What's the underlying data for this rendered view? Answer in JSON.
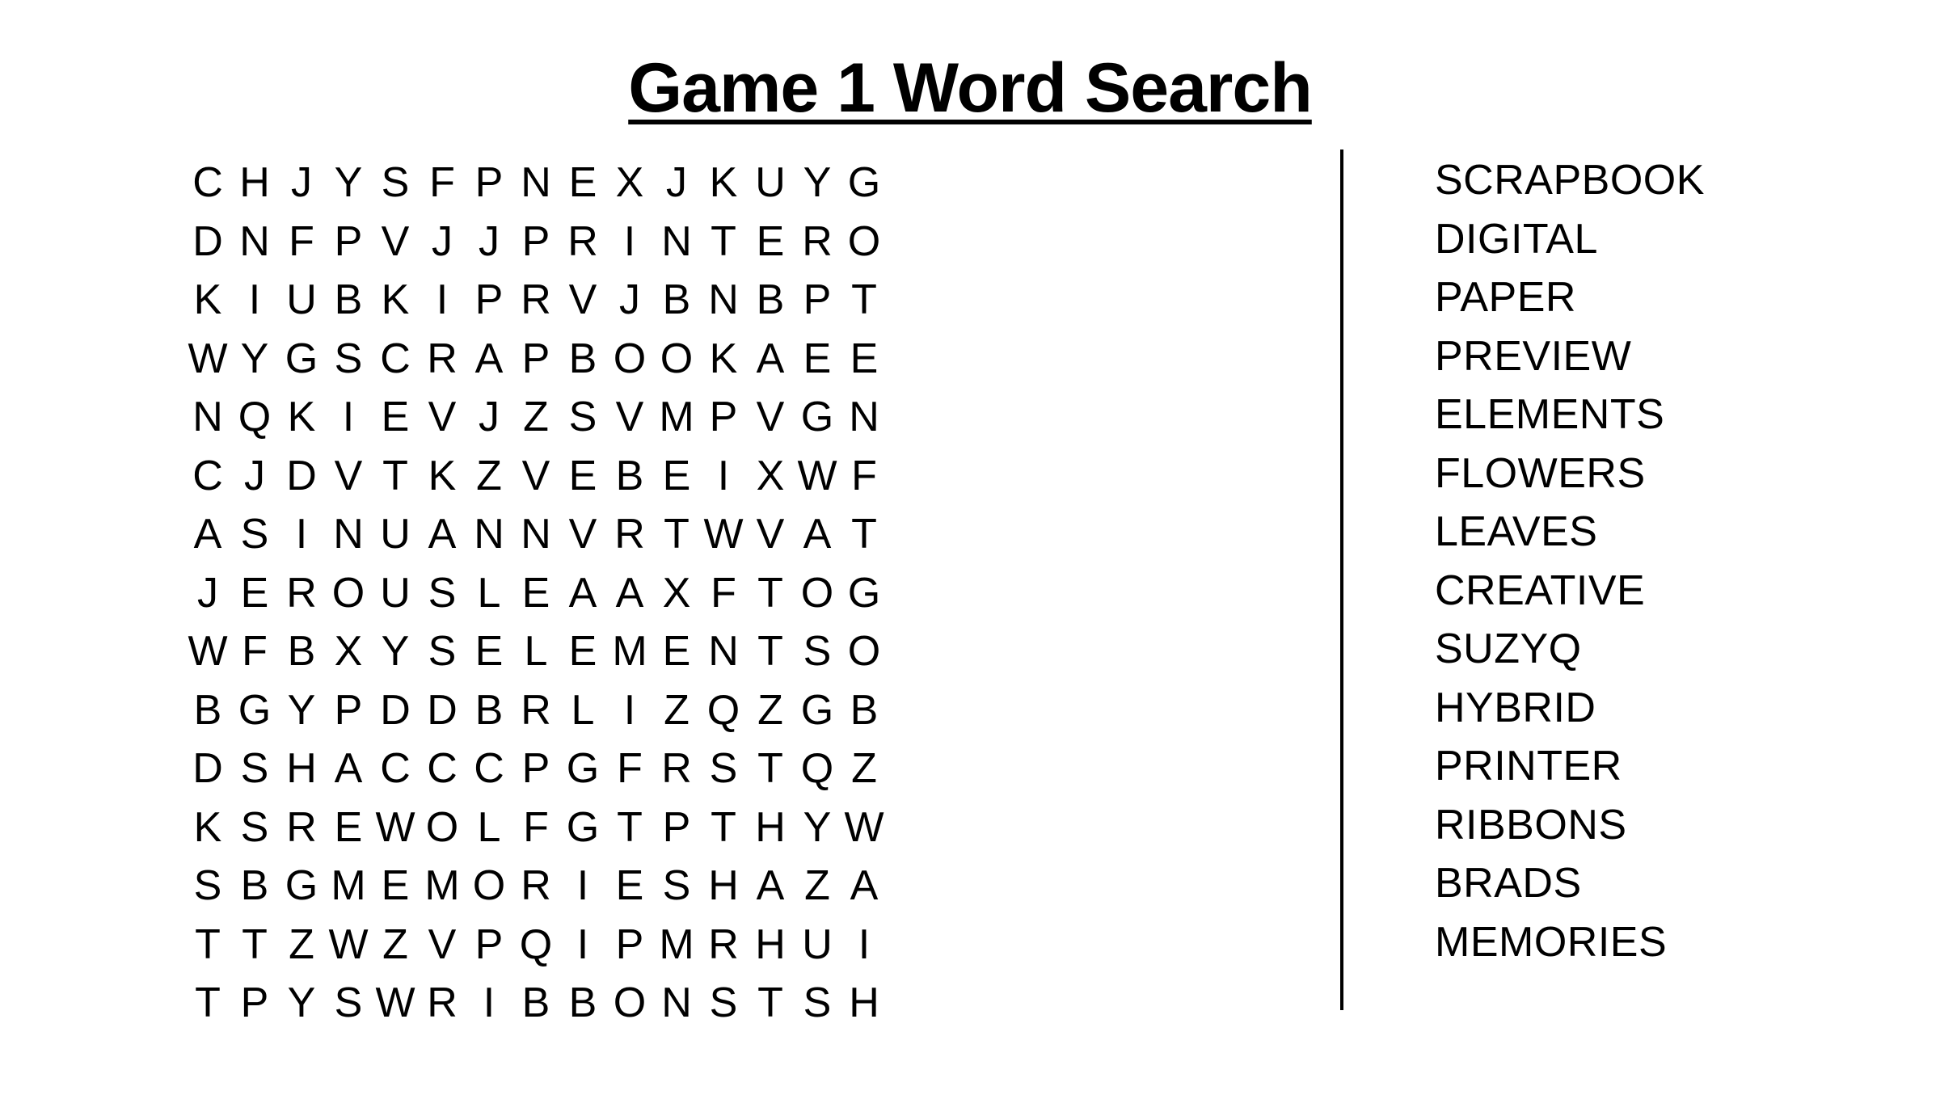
{
  "page": {
    "title": "Game 1 Word Search",
    "background_color": "#ffffff",
    "text_color": "#000000"
  },
  "puzzle": {
    "rows": 15,
    "columns": 15,
    "divider_color": "#000000",
    "grid": [
      [
        "C",
        "H",
        "J",
        "Y",
        "S",
        "F",
        "P",
        "N",
        "E",
        "X",
        "J",
        "K",
        "U",
        "Y",
        "G"
      ],
      [
        "D",
        "N",
        "F",
        "P",
        "V",
        "J",
        "J",
        "P",
        "R",
        "I",
        "N",
        "T",
        "E",
        "R",
        "O"
      ],
      [
        "K",
        "I",
        "U",
        "B",
        "K",
        "I",
        "P",
        "R",
        "V",
        "J",
        "B",
        "N",
        "B",
        "P",
        "T"
      ],
      [
        "W",
        "Y",
        "G",
        "S",
        "C",
        "R",
        "A",
        "P",
        "B",
        "O",
        "O",
        "K",
        "A",
        "E",
        "E"
      ],
      [
        "N",
        "Q",
        "K",
        "I",
        "E",
        "V",
        "J",
        "Z",
        "S",
        "V",
        "M",
        "P",
        "V",
        "G",
        "N"
      ],
      [
        "C",
        "J",
        "D",
        "V",
        "T",
        "K",
        "Z",
        "V",
        "E",
        "B",
        "E",
        "I",
        "X",
        "W",
        "F"
      ],
      [
        "A",
        "S",
        "I",
        "N",
        "U",
        "A",
        "N",
        "N",
        "V",
        "R",
        "T",
        "W",
        "V",
        "A",
        "T"
      ],
      [
        "J",
        "E",
        "R",
        "O",
        "U",
        "S",
        "L",
        "E",
        "A",
        "A",
        "X",
        "F",
        "T",
        "O",
        "G"
      ],
      [
        "W",
        "F",
        "B",
        "X",
        "Y",
        "S",
        "E",
        "L",
        "E",
        "M",
        "E",
        "N",
        "T",
        "S",
        "O"
      ],
      [
        "B",
        "G",
        "Y",
        "P",
        "D",
        "D",
        "B",
        "R",
        "L",
        "I",
        "Z",
        "Q",
        "Z",
        "G",
        "B"
      ],
      [
        "D",
        "S",
        "H",
        "A",
        "C",
        "C",
        "C",
        "P",
        "G",
        "F",
        "R",
        "S",
        "T",
        "Q",
        "Z"
      ],
      [
        "K",
        "S",
        "R",
        "E",
        "W",
        "O",
        "L",
        "F",
        "G",
        "T",
        "P",
        "T",
        "H",
        "Y",
        "W"
      ],
      [
        "S",
        "B",
        "G",
        "M",
        "E",
        "M",
        "O",
        "R",
        "I",
        "E",
        "S",
        "H",
        "A",
        "Z",
        "A"
      ],
      [
        "T",
        "T",
        "Z",
        "W",
        "Z",
        "V",
        "P",
        "Q",
        "I",
        "P",
        "M",
        "R",
        "H",
        "U",
        "I"
      ],
      [
        "T",
        "P",
        "Y",
        "S",
        "W",
        "R",
        "I",
        "B",
        "B",
        "O",
        "N",
        "S",
        "T",
        "S",
        "H"
      ]
    ]
  },
  "word_list": {
    "words": [
      "SCRAPBOOK",
      "DIGITAL",
      "PAPER",
      "PREVIEW",
      "ELEMENTS",
      "FLOWERS",
      "LEAVES",
      "CREATIVE",
      "SUZYQ",
      "HYBRID",
      "PRINTER",
      "RIBBONS",
      "BRADS",
      "MEMORIES"
    ]
  }
}
